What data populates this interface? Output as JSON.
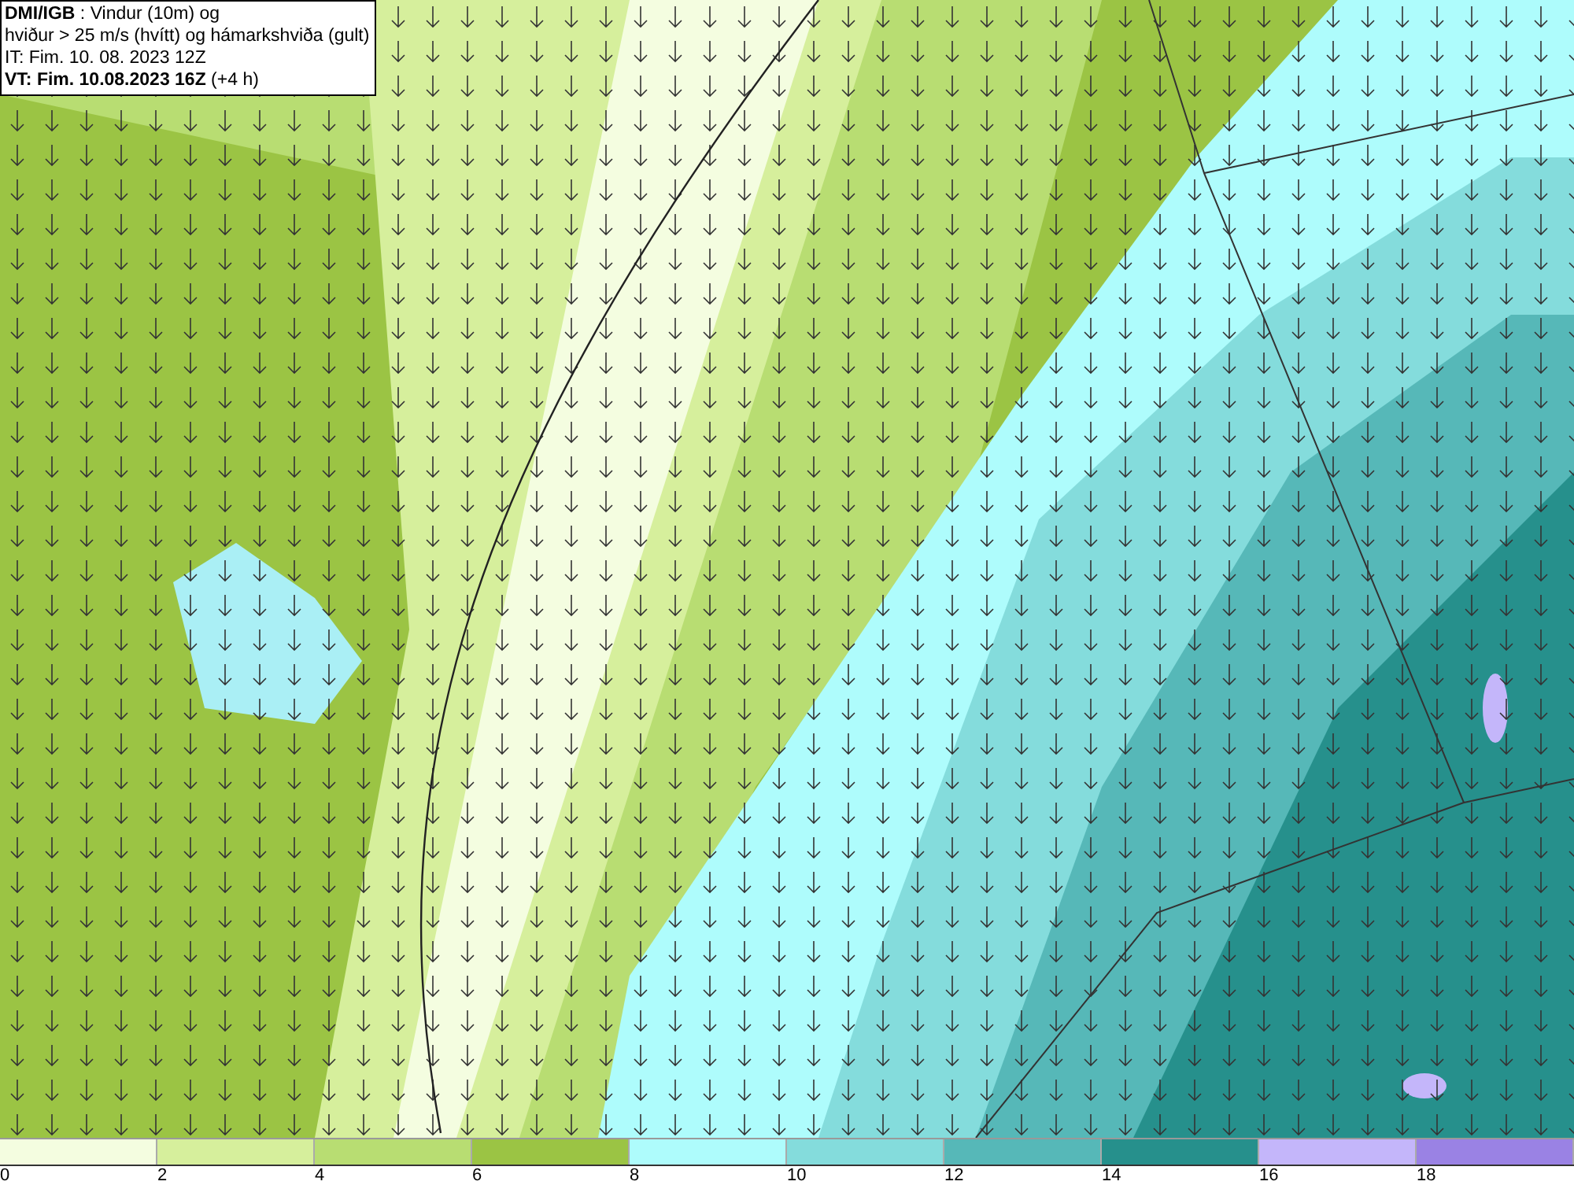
{
  "header": {
    "lines": [
      "**DMI/IGB** : Vindur (10m) og",
      "hviður > 25 m/s (hvítt) og hámarkshviða (gult)",
      "IT: Fim. 10. 08. 2023 12Z",
      "**VT: Fim. 10.08.2023 16Z** (+4 h)"
    ]
  },
  "legend": {
    "bins": [
      {
        "color": "#f4fde0"
      },
      {
        "color": "#d6ef9c"
      },
      {
        "color": "#b8dd72"
      },
      {
        "color": "#9bc444"
      },
      {
        "color": "#aefcfc"
      },
      {
        "color": "#84dcdc"
      },
      {
        "color": "#56b8b8"
      },
      {
        "color": "#26908c"
      },
      {
        "color": "#c4b6fa"
      },
      {
        "color": "#9a82e4"
      }
    ],
    "ticks": [
      "0",
      "2",
      "4",
      "6",
      "8",
      "10",
      "12",
      "14",
      "16",
      "18"
    ]
  }
}
